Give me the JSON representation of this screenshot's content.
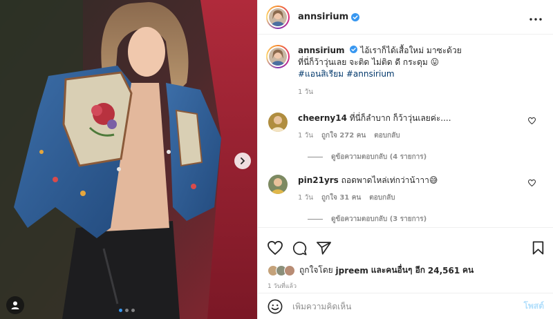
{
  "post": {
    "username": "annsirium",
    "more_icon": "more-horizontal-icon",
    "caption": {
      "username": "annsirium",
      "line1": "ไอ้เราก็ได้เสื้อใหม่ มาซะด้วย",
      "line2": "ที่นี่ก็ว้าวุ่นเลย จะติด ไม่ติด ดี กระดุม 😛",
      "hashtag1": "#แอนสิเรียม",
      "hashtag2": "#annsirium",
      "time": "1 วัน"
    },
    "image": {
      "carousel_dots": 3,
      "active_dot": 1
    }
  },
  "comments": [
    {
      "username": "cheerny14",
      "text": "ที่นี่ก็ลำบาก ก็ว้าวุ่นเลยค่ะ....",
      "time": "1 วัน",
      "likes": "ถูกใจ 272 คน",
      "reply": "ตอบกลับ",
      "view_replies": "ดูข้อความตอบกลับ (4 รายการ)"
    },
    {
      "username": "pin21yrs",
      "text": "ถอดพาดไหล่เท่กว่าน้าาา😅",
      "time": "1 วัน",
      "likes": "ถูกใจ 31 คน",
      "reply": "ตอบกลับ",
      "view_replies": "ดูข้อความตอบกลับ (3 รายการ)"
    }
  ],
  "engagement": {
    "liked_prefix": "ถูกใจโดย",
    "liked_user": "jpreem",
    "liked_mid": "และคนอื่นๆ อีก",
    "liked_count": "24,561",
    "liked_suffix": "คน",
    "time_ago": "1 วันที่แล้ว"
  },
  "comment_box": {
    "placeholder": "เพิ่มความคิดเห็น",
    "post_label": "โพสต์"
  },
  "colors": {
    "verified": "#3897f0",
    "hashtag": "#00376b",
    "post_disabled": "#b2dffc",
    "muted": "#8e8e8e"
  }
}
